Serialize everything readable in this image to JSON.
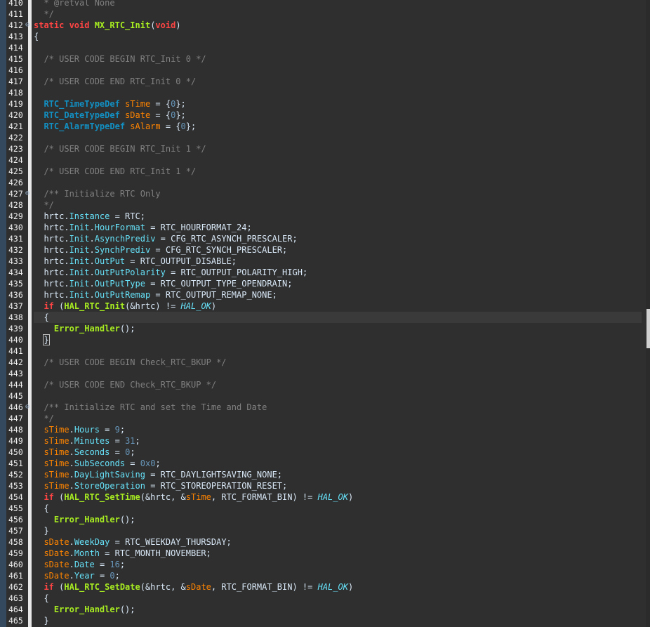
{
  "editor": {
    "lines": [
      {
        "n": "410",
        "t": [
          [
            "cm",
            "  * @retval None"
          ]
        ]
      },
      {
        "n": "411",
        "t": [
          [
            "cm",
            "  */"
          ]
        ]
      },
      {
        "n": "412",
        "fold": true,
        "t": [
          [
            "kw",
            "static void "
          ],
          [
            "fn",
            "MX_RTC_Init"
          ],
          [
            "pl",
            "("
          ],
          [
            "kw",
            "void"
          ],
          [
            "pl",
            ")"
          ]
        ]
      },
      {
        "n": "413",
        "t": [
          [
            "pl",
            "{"
          ]
        ]
      },
      {
        "n": "414",
        "t": []
      },
      {
        "n": "415",
        "t": [
          [
            "cm",
            "  /* USER CODE BEGIN RTC_Init 0 */"
          ]
        ]
      },
      {
        "n": "416",
        "t": []
      },
      {
        "n": "417",
        "t": [
          [
            "cm",
            "  /* USER CODE END RTC_Init 0 */"
          ]
        ]
      },
      {
        "n": "418",
        "t": []
      },
      {
        "n": "419",
        "t": [
          [
            "pl",
            "  "
          ],
          [
            "ty",
            "RTC_TimeTypeDef"
          ],
          [
            "pl",
            " "
          ],
          [
            "sv",
            "sTime"
          ],
          [
            "pl",
            " = {"
          ],
          [
            "num",
            "0"
          ],
          [
            "pl",
            "};"
          ]
        ]
      },
      {
        "n": "420",
        "t": [
          [
            "pl",
            "  "
          ],
          [
            "ty",
            "RTC_DateTypeDef"
          ],
          [
            "pl",
            " "
          ],
          [
            "sv",
            "sDate"
          ],
          [
            "pl",
            " = {"
          ],
          [
            "num",
            "0"
          ],
          [
            "pl",
            "};"
          ]
        ]
      },
      {
        "n": "421",
        "t": [
          [
            "pl",
            "  "
          ],
          [
            "ty",
            "RTC_AlarmTypeDef"
          ],
          [
            "pl",
            " "
          ],
          [
            "sv",
            "sAlarm"
          ],
          [
            "pl",
            " = {"
          ],
          [
            "num",
            "0"
          ],
          [
            "pl",
            "};"
          ]
        ]
      },
      {
        "n": "422",
        "t": []
      },
      {
        "n": "423",
        "t": [
          [
            "cm",
            "  /* USER CODE BEGIN RTC_Init 1 */"
          ]
        ]
      },
      {
        "n": "424",
        "t": []
      },
      {
        "n": "425",
        "t": [
          [
            "cm",
            "  /* USER CODE END RTC_Init 1 */"
          ]
        ]
      },
      {
        "n": "426",
        "t": []
      },
      {
        "n": "427",
        "fold": true,
        "t": [
          [
            "cm",
            "  /** Initialize RTC Only"
          ]
        ]
      },
      {
        "n": "428",
        "t": [
          [
            "cm",
            "  */"
          ]
        ]
      },
      {
        "n": "429",
        "t": [
          [
            "pl",
            "  hrtc."
          ],
          [
            "fld",
            "Instance"
          ],
          [
            "pl",
            " = RTC;"
          ]
        ]
      },
      {
        "n": "430",
        "t": [
          [
            "pl",
            "  hrtc."
          ],
          [
            "fld",
            "Init"
          ],
          [
            "pl",
            "."
          ],
          [
            "fld",
            "HourFormat"
          ],
          [
            "pl",
            " = RTC_HOURFORMAT_24;"
          ]
        ]
      },
      {
        "n": "431",
        "t": [
          [
            "pl",
            "  hrtc."
          ],
          [
            "fld",
            "Init"
          ],
          [
            "pl",
            "."
          ],
          [
            "fld",
            "AsynchPrediv"
          ],
          [
            "pl",
            " = CFG_RTC_ASYNCH_PRESCALER;"
          ]
        ]
      },
      {
        "n": "432",
        "t": [
          [
            "pl",
            "  hrtc."
          ],
          [
            "fld",
            "Init"
          ],
          [
            "pl",
            "."
          ],
          [
            "fld",
            "SynchPrediv"
          ],
          [
            "pl",
            " = CFG_RTC_SYNCH_PRESCALER;"
          ]
        ]
      },
      {
        "n": "433",
        "t": [
          [
            "pl",
            "  hrtc."
          ],
          [
            "fld",
            "Init"
          ],
          [
            "pl",
            "."
          ],
          [
            "fld",
            "OutPut"
          ],
          [
            "pl",
            " = RTC_OUTPUT_DISABLE;"
          ]
        ]
      },
      {
        "n": "434",
        "t": [
          [
            "pl",
            "  hrtc."
          ],
          [
            "fld",
            "Init"
          ],
          [
            "pl",
            "."
          ],
          [
            "fld",
            "OutPutPolarity"
          ],
          [
            "pl",
            " = RTC_OUTPUT_POLARITY_HIGH;"
          ]
        ]
      },
      {
        "n": "435",
        "t": [
          [
            "pl",
            "  hrtc."
          ],
          [
            "fld",
            "Init"
          ],
          [
            "pl",
            "."
          ],
          [
            "fld",
            "OutPutType"
          ],
          [
            "pl",
            " = RTC_OUTPUT_TYPE_OPENDRAIN;"
          ]
        ]
      },
      {
        "n": "436",
        "t": [
          [
            "pl",
            "  hrtc."
          ],
          [
            "fld",
            "Init"
          ],
          [
            "pl",
            "."
          ],
          [
            "fld",
            "OutPutRemap"
          ],
          [
            "pl",
            " = RTC_OUTPUT_REMAP_NONE;"
          ]
        ]
      },
      {
        "n": "437",
        "t": [
          [
            "pl",
            "  "
          ],
          [
            "kw",
            "if"
          ],
          [
            "pl",
            " ("
          ],
          [
            "fn",
            "HAL_RTC_Init"
          ],
          [
            "pl",
            "(&hrtc) != "
          ],
          [
            "ital",
            "HAL_OK"
          ],
          [
            "pl",
            ")"
          ]
        ]
      },
      {
        "n": "438",
        "current": true,
        "t": [
          [
            "pl",
            "  {"
          ]
        ]
      },
      {
        "n": "439",
        "t": [
          [
            "pl",
            "    "
          ],
          [
            "fn",
            "Error_Handler"
          ],
          [
            "pl",
            "();"
          ]
        ]
      },
      {
        "n": "440",
        "t": [
          [
            "pl",
            "  "
          ],
          [
            "brk",
            "}"
          ]
        ]
      },
      {
        "n": "441",
        "t": []
      },
      {
        "n": "442",
        "t": [
          [
            "cm",
            "  /* USER CODE BEGIN Check_RTC_BKUP */"
          ]
        ]
      },
      {
        "n": "443",
        "t": []
      },
      {
        "n": "444",
        "t": [
          [
            "cm",
            "  /* USER CODE END Check_RTC_BKUP */"
          ]
        ]
      },
      {
        "n": "445",
        "t": []
      },
      {
        "n": "446",
        "fold": true,
        "t": [
          [
            "cm",
            "  /** Initialize RTC and set the Time and Date"
          ]
        ]
      },
      {
        "n": "447",
        "t": [
          [
            "cm",
            "  */"
          ]
        ]
      },
      {
        "n": "448",
        "t": [
          [
            "pl",
            "  "
          ],
          [
            "sv",
            "sTime"
          ],
          [
            "pl",
            "."
          ],
          [
            "fld",
            "Hours"
          ],
          [
            "pl",
            " = "
          ],
          [
            "num",
            "9"
          ],
          [
            "pl",
            ";"
          ]
        ]
      },
      {
        "n": "449",
        "t": [
          [
            "pl",
            "  "
          ],
          [
            "sv",
            "sTime"
          ],
          [
            "pl",
            "."
          ],
          [
            "fld",
            "Minutes"
          ],
          [
            "pl",
            " = "
          ],
          [
            "num",
            "31"
          ],
          [
            "pl",
            ";"
          ]
        ]
      },
      {
        "n": "450",
        "t": [
          [
            "pl",
            "  "
          ],
          [
            "sv",
            "sTime"
          ],
          [
            "pl",
            "."
          ],
          [
            "fld",
            "Seconds"
          ],
          [
            "pl",
            " = "
          ],
          [
            "num",
            "0"
          ],
          [
            "pl",
            ";"
          ]
        ]
      },
      {
        "n": "451",
        "t": [
          [
            "pl",
            "  "
          ],
          [
            "sv",
            "sTime"
          ],
          [
            "pl",
            "."
          ],
          [
            "fld",
            "SubSeconds"
          ],
          [
            "pl",
            " = "
          ],
          [
            "num",
            "0x0"
          ],
          [
            "pl",
            ";"
          ]
        ]
      },
      {
        "n": "452",
        "t": [
          [
            "pl",
            "  "
          ],
          [
            "sv",
            "sTime"
          ],
          [
            "pl",
            "."
          ],
          [
            "fld",
            "DayLightSaving"
          ],
          [
            "pl",
            " = RTC_DAYLIGHTSAVING_NONE;"
          ]
        ]
      },
      {
        "n": "453",
        "t": [
          [
            "pl",
            "  "
          ],
          [
            "sv",
            "sTime"
          ],
          [
            "pl",
            "."
          ],
          [
            "fld",
            "StoreOperation"
          ],
          [
            "pl",
            " = RTC_STOREOPERATION_RESET;"
          ]
        ]
      },
      {
        "n": "454",
        "t": [
          [
            "pl",
            "  "
          ],
          [
            "kw",
            "if"
          ],
          [
            "pl",
            " ("
          ],
          [
            "fn",
            "HAL_RTC_SetTime"
          ],
          [
            "pl",
            "(&hrtc, &"
          ],
          [
            "sv",
            "sTime"
          ],
          [
            "pl",
            ", RTC_FORMAT_BIN) != "
          ],
          [
            "ital",
            "HAL_OK"
          ],
          [
            "pl",
            ")"
          ]
        ]
      },
      {
        "n": "455",
        "t": [
          [
            "pl",
            "  {"
          ]
        ]
      },
      {
        "n": "456",
        "t": [
          [
            "pl",
            "    "
          ],
          [
            "fn",
            "Error_Handler"
          ],
          [
            "pl",
            "();"
          ]
        ]
      },
      {
        "n": "457",
        "t": [
          [
            "pl",
            "  }"
          ]
        ]
      },
      {
        "n": "458",
        "t": [
          [
            "pl",
            "  "
          ],
          [
            "sv",
            "sDate"
          ],
          [
            "pl",
            "."
          ],
          [
            "fld",
            "WeekDay"
          ],
          [
            "pl",
            " = RTC_WEEKDAY_THURSDAY;"
          ]
        ]
      },
      {
        "n": "459",
        "t": [
          [
            "pl",
            "  "
          ],
          [
            "sv",
            "sDate"
          ],
          [
            "pl",
            "."
          ],
          [
            "fld",
            "Month"
          ],
          [
            "pl",
            " = RTC_MONTH_NOVEMBER;"
          ]
        ]
      },
      {
        "n": "460",
        "t": [
          [
            "pl",
            "  "
          ],
          [
            "sv",
            "sDate"
          ],
          [
            "pl",
            "."
          ],
          [
            "fld",
            "Date"
          ],
          [
            "pl",
            " = "
          ],
          [
            "num",
            "16"
          ],
          [
            "pl",
            ";"
          ]
        ]
      },
      {
        "n": "461",
        "t": [
          [
            "pl",
            "  "
          ],
          [
            "sv",
            "sDate"
          ],
          [
            "pl",
            "."
          ],
          [
            "fld",
            "Year"
          ],
          [
            "pl",
            " = "
          ],
          [
            "num",
            "0"
          ],
          [
            "pl",
            ";"
          ]
        ]
      },
      {
        "n": "462",
        "t": [
          [
            "pl",
            "  "
          ],
          [
            "kw",
            "if"
          ],
          [
            "pl",
            " ("
          ],
          [
            "fn",
            "HAL_RTC_SetDate"
          ],
          [
            "pl",
            "(&hrtc, &"
          ],
          [
            "sv",
            "sDate"
          ],
          [
            "pl",
            ", RTC_FORMAT_BIN) != "
          ],
          [
            "ital",
            "HAL_OK"
          ],
          [
            "pl",
            ")"
          ]
        ]
      },
      {
        "n": "463",
        "t": [
          [
            "pl",
            "  {"
          ]
        ]
      },
      {
        "n": "464",
        "t": [
          [
            "pl",
            "    "
          ],
          [
            "fn",
            "Error_Handler"
          ],
          [
            "pl",
            "();"
          ]
        ]
      },
      {
        "n": "465",
        "t": [
          [
            "pl",
            "  }"
          ]
        ]
      }
    ],
    "colors": {
      "background": "#2f2f2f",
      "keyword": "#ff4444",
      "function": "#a7ec21",
      "type": "#1290c3",
      "comment": "#808080",
      "field": "#66e1f8",
      "struct_var": "#ff8400",
      "number": "#6897bb",
      "plain": "#d9e8f7"
    },
    "icons": {
      "fold": "fold-marker-icon"
    }
  }
}
